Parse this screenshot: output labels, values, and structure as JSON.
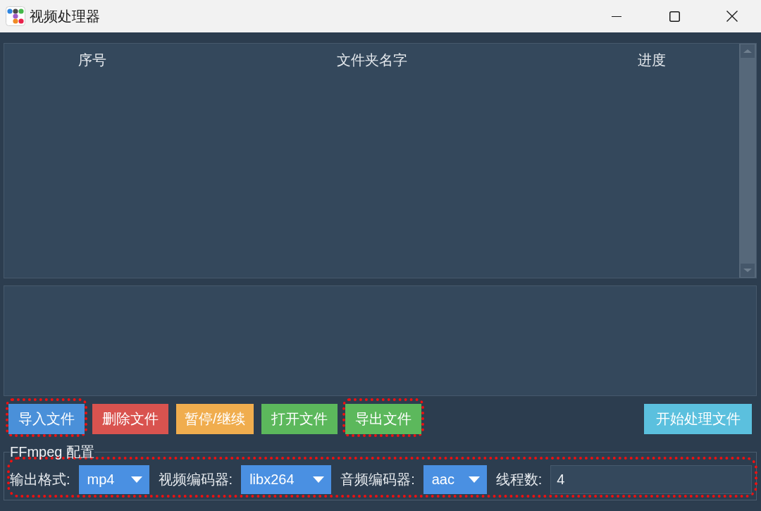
{
  "window": {
    "title": "视频处理器"
  },
  "table": {
    "columns": [
      "序号",
      "文件夹名字",
      "进度"
    ]
  },
  "actions": [
    {
      "label": "导入文件",
      "kind": "primary",
      "highlighted": true
    },
    {
      "label": "删除文件",
      "kind": "danger",
      "highlighted": false
    },
    {
      "label": "暂停/继续",
      "kind": "warning",
      "highlighted": false
    },
    {
      "label": "打开文件",
      "kind": "success",
      "highlighted": false
    },
    {
      "label": "导出文件",
      "kind": "success",
      "highlighted": true
    }
  ],
  "start_button": {
    "label": "开始处理文件",
    "kind": "info"
  },
  "config": {
    "title": "FFmpeg 配置",
    "highlighted": true,
    "fields": [
      {
        "kind": "dropdown",
        "label": "输出格式:",
        "value": "mp4"
      },
      {
        "kind": "dropdown",
        "label": "视频编码器:",
        "value": "libx264"
      },
      {
        "kind": "dropdown",
        "label": "音频编码器:",
        "value": "aac"
      },
      {
        "kind": "input",
        "label": "线程数:",
        "value": "4"
      }
    ]
  }
}
